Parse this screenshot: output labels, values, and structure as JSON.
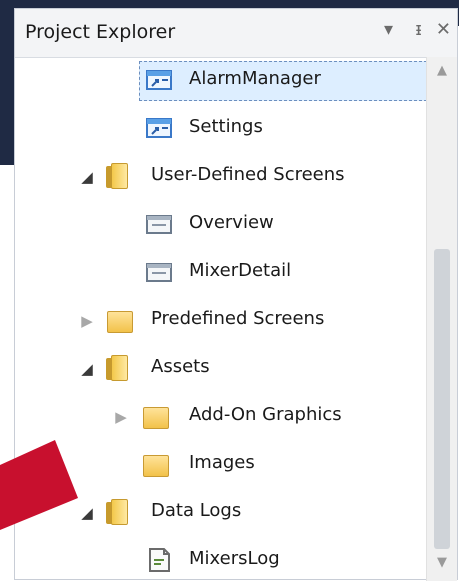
{
  "panel": {
    "title": "Project Explorer",
    "menu_glyph": "▾",
    "pin_glyph": "ᵻ",
    "close_glyph": "✕"
  },
  "tree": [
    {
      "label": "AlarmManager",
      "icon": "screen-shortcut-icon",
      "state": "selected"
    },
    {
      "label": "Settings",
      "icon": "screen-shortcut-icon",
      "state": "normal"
    },
    {
      "label": "User-Defined Screens",
      "icon": "folder-icon",
      "state": "expanded"
    },
    {
      "label": "Overview",
      "icon": "screen-icon",
      "state": "normal"
    },
    {
      "label": "MixerDetail",
      "icon": "screen-icon",
      "state": "normal"
    },
    {
      "label": "Predefined Screens",
      "icon": "folder-icon",
      "state": "collapsed"
    },
    {
      "label": "Assets",
      "icon": "folder-icon",
      "state": "expanded"
    },
    {
      "label": "Add-On Graphics",
      "icon": "folder-icon",
      "state": "collapsed"
    },
    {
      "label": "Images",
      "icon": "folder-icon",
      "state": "normal"
    },
    {
      "label": "Data Logs",
      "icon": "folder-icon",
      "state": "expanded"
    },
    {
      "label": "MixersLog",
      "icon": "data-log-icon",
      "state": "normal"
    }
  ],
  "colors": {
    "annotation_arrow": "#c8102e",
    "selection": "#ddeeff",
    "folder": "#f2c24a"
  }
}
